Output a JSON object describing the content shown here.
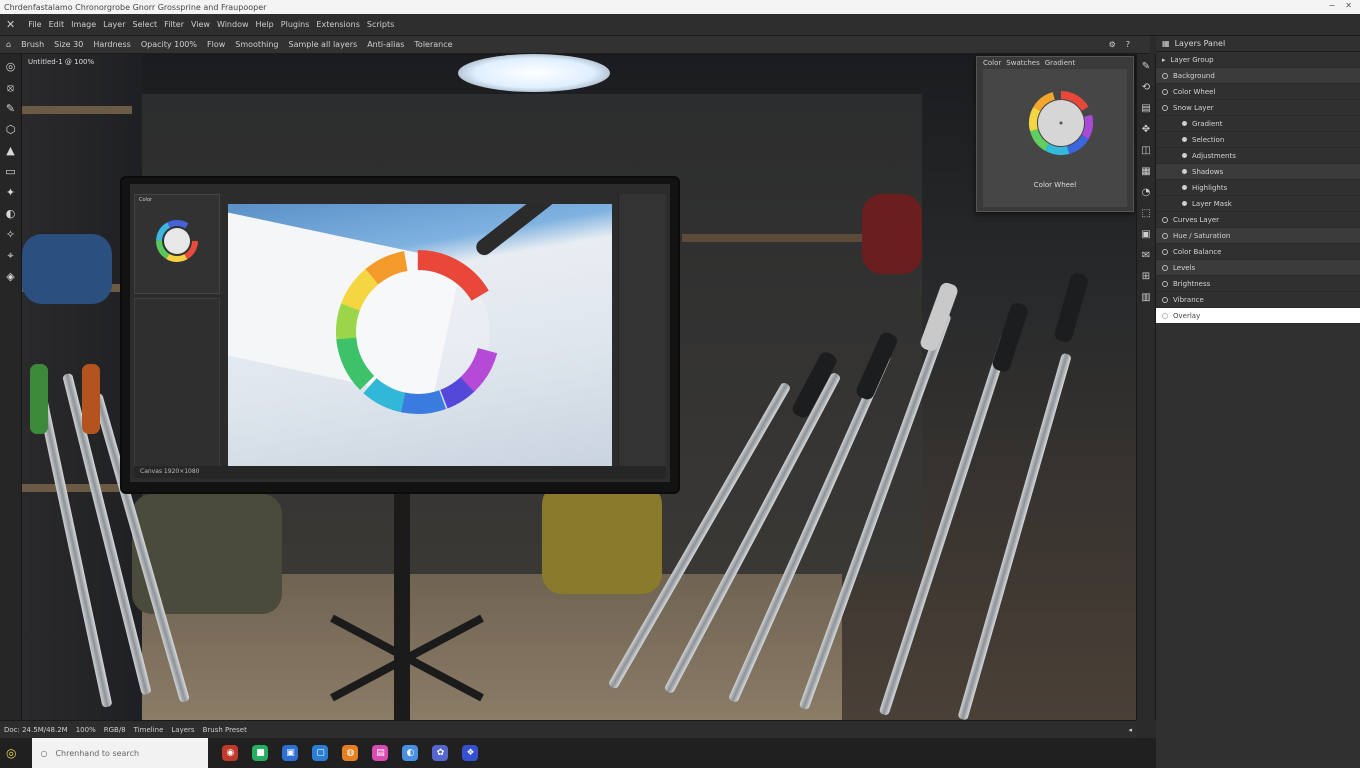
{
  "title_bar": {
    "app_title": "Chrdenfastalamo Chronorgrobe Gnorr Grossprine and Fraupooper",
    "minimize": "−",
    "close": "✕"
  },
  "menu": [
    "File",
    "Edit",
    "Image",
    "Layer",
    "Select",
    "Filter",
    "View",
    "Window",
    "Help",
    "Plugins",
    "Extensions",
    "Scripts"
  ],
  "options": [
    "Brush",
    "Size 30",
    "Hardness",
    "Opacity 100%",
    "Flow",
    "Smoothing",
    "Sample all layers",
    "Anti-alias",
    "Tolerance"
  ],
  "canvas_label": "Untitled-1 @ 100%",
  "tools": [
    "◎",
    "⦻",
    "✎",
    "⬡",
    "▲",
    "▭",
    "✦",
    "◐",
    "✧",
    "⌖",
    "◈"
  ],
  "strip_tools": [
    "✎",
    "⟲",
    "▤",
    "✥",
    "◫",
    "▦",
    "◔",
    "⬚",
    "▣",
    "✉",
    "⊞",
    "▥"
  ],
  "monitor_screen": {
    "left_panel_label": "Color",
    "status": "Canvas 1920×1080"
  },
  "color_panel": {
    "tabs": [
      "Color",
      "Swatches",
      "Gradient"
    ],
    "label": "Color Wheel"
  },
  "layers_panel": {
    "header": "Layers Panel",
    "group": "Layer Group",
    "rows": [
      {
        "label": "Background",
        "kind": "group",
        "style": "alt"
      },
      {
        "label": "Color Wheel",
        "kind": "ring",
        "style": ""
      },
      {
        "label": "Snow Layer",
        "kind": "ring",
        "style": ""
      },
      {
        "label": "Gradient",
        "kind": "dot",
        "style": ""
      },
      {
        "label": "Selection",
        "kind": "dot",
        "style": ""
      },
      {
        "label": "Adjustments",
        "kind": "dot",
        "style": ""
      },
      {
        "label": "Shadows",
        "kind": "dot",
        "style": "alt"
      },
      {
        "label": "Highlights",
        "kind": "dot",
        "style": ""
      },
      {
        "label": "Layer Mask",
        "kind": "dot",
        "style": ""
      },
      {
        "label": "Curves Layer",
        "kind": "ring",
        "style": ""
      },
      {
        "label": "Hue / Saturation",
        "kind": "ring",
        "style": "alt"
      },
      {
        "label": "Color Balance",
        "kind": "ring",
        "style": ""
      },
      {
        "label": "Levels",
        "kind": "ring",
        "style": "alt"
      },
      {
        "label": "Brightness",
        "kind": "ring",
        "style": ""
      },
      {
        "label": "Vibrance",
        "kind": "ring",
        "style": ""
      },
      {
        "label": "Overlay",
        "kind": "ring",
        "style": "sel"
      }
    ]
  },
  "status_bar": [
    "Doc: 24.5M/48.2M",
    "100%",
    "RGB/8",
    "Timeline",
    "Layers",
    "Brush Preset"
  ],
  "taskbar": {
    "search_placeholder": "Chrenhand to search",
    "apps": [
      {
        "glyph": "◉",
        "color": "#c0392b"
      },
      {
        "glyph": "■",
        "color": "#27ae60"
      },
      {
        "glyph": "▣",
        "color": "#2e6fd3"
      },
      {
        "glyph": "▢",
        "color": "#2a7fd4"
      },
      {
        "glyph": "◍",
        "color": "#e67e22"
      },
      {
        "glyph": "▤",
        "color": "#d94bb0"
      },
      {
        "glyph": "◐",
        "color": "#4a90e2"
      },
      {
        "glyph": "✿",
        "color": "#5566cc"
      },
      {
        "glyph": "❖",
        "color": "#3550d0"
      }
    ]
  }
}
